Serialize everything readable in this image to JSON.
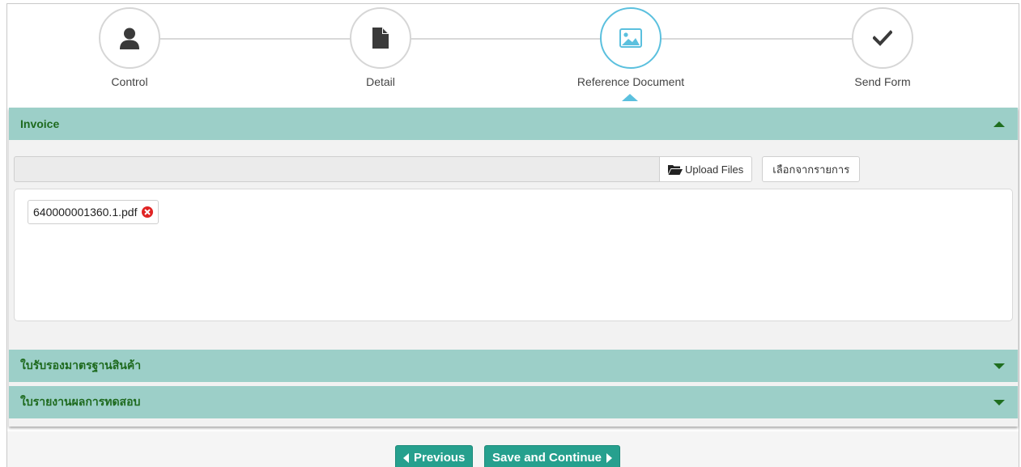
{
  "wizard": {
    "steps": [
      {
        "label": "Control",
        "icon": "user-icon",
        "active": false
      },
      {
        "label": "Detail",
        "icon": "document-icon",
        "active": false
      },
      {
        "label": "Reference Document",
        "icon": "image-icon",
        "active": true
      },
      {
        "label": "Send Form",
        "icon": "checkmark-icon",
        "active": false
      }
    ]
  },
  "sections": [
    {
      "title": "Invoice",
      "expanded": true
    },
    {
      "title": "ใบรับรองมาตรฐานสินค้า",
      "expanded": false
    },
    {
      "title": "ใบรายงานผลการทดสอบ",
      "expanded": false
    }
  ],
  "upload": {
    "upload_label": "Upload Files",
    "select_label": "เลือกจากรายการ"
  },
  "files": [
    {
      "name": "640000001360.1.pdf"
    }
  ],
  "footer": {
    "previous_label": "Previous",
    "save_label": "Save and Continue"
  },
  "colors": {
    "accent": "#5bc0de",
    "header_bg": "#9ccfc8",
    "header_text": "#1e6a1e",
    "button": "#26a08e",
    "remove": "#e02424"
  }
}
